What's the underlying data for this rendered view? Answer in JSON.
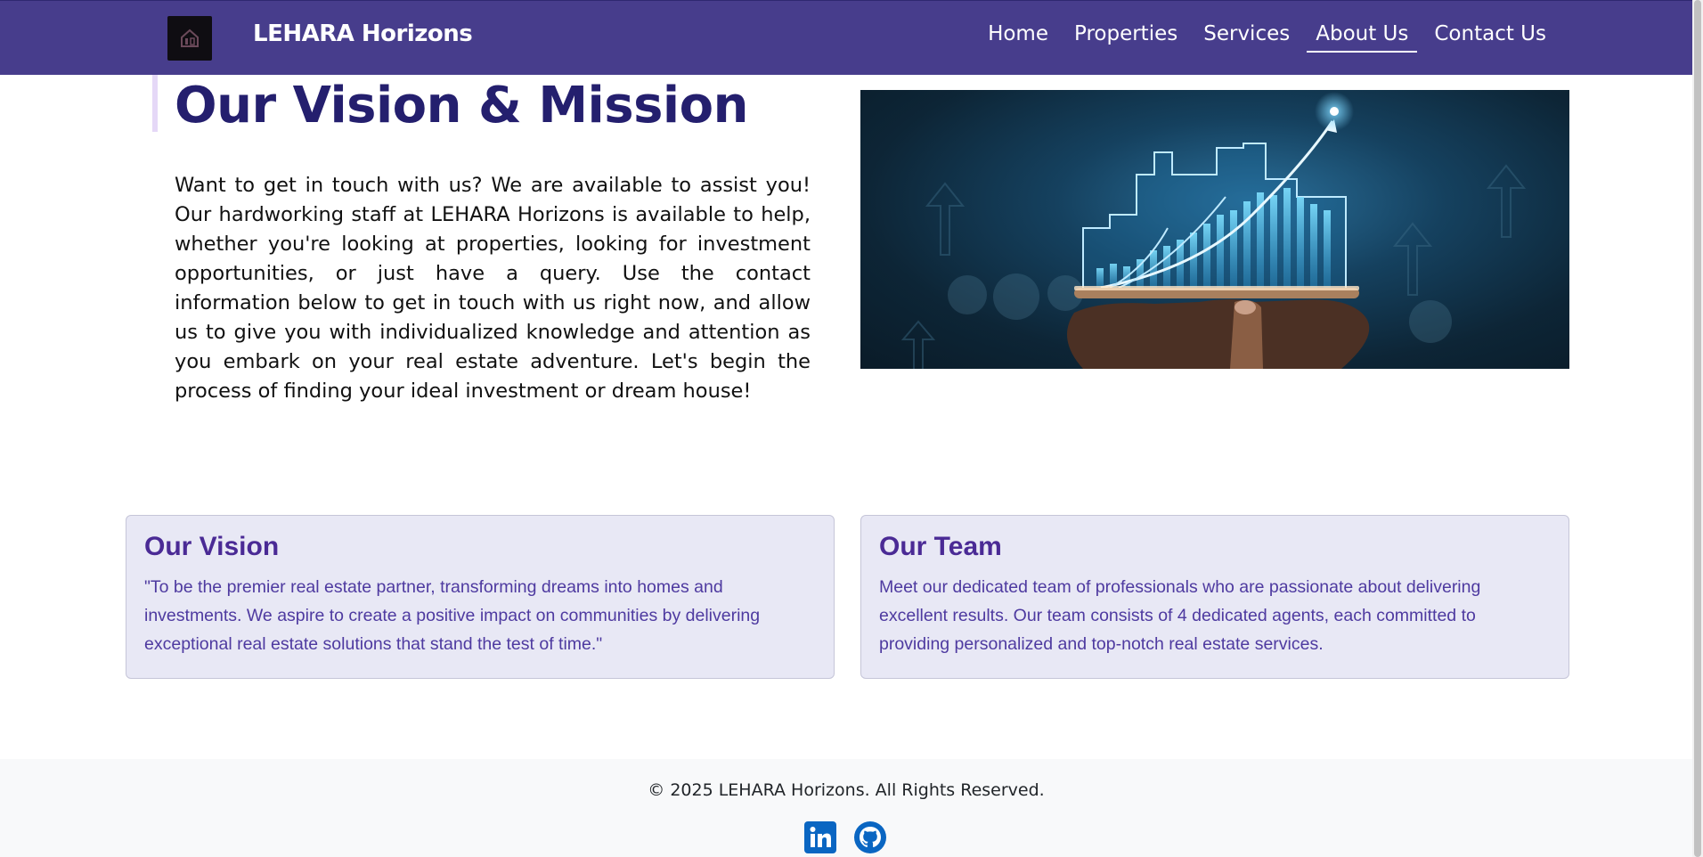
{
  "nav": {
    "brand": "LEHARA Horizons",
    "logo_icon": "house-logo-icon",
    "links": [
      "Home",
      "Properties",
      "Services",
      "About Us",
      "Contact Us"
    ],
    "active": "About Us",
    "color": "#473d8c"
  },
  "intro": {
    "title": "Our Vision & Mission",
    "text": "Want to get in touch with us? We are available to assist you! Our hardworking staff at LEHARA Horizons is available to help, whether you're looking at properties, looking for investment opportunities, or just have a query. Use the contact information below to get in touch with us right now, and allow us to give you with individualized knowledge and attention as you embark on your real estate adventure. Let's begin the process of finding your ideal investment or dream house!",
    "image": "growth-chart-city-hand-photo"
  },
  "cards": [
    {
      "title": "Our Vision",
      "text": "\"To be the premier real estate partner, transforming dreams into homes and investments. We aspire to create a positive impact on communities by delivering exceptional real estate solutions that stand the test of time.\""
    },
    {
      "title": "Our Team",
      "text": "Meet our dedicated team of professionals who are passionate about delivering excellent results. Our team consists of 4 dedicated agents, each committed to providing personalized and top-notch real estate services."
    }
  ],
  "footer": {
    "copyright": "© 2025 LEHARA Horizons. All Rights Reserved.",
    "social_icons": [
      "linkedin-icon",
      "github-icon"
    ]
  }
}
